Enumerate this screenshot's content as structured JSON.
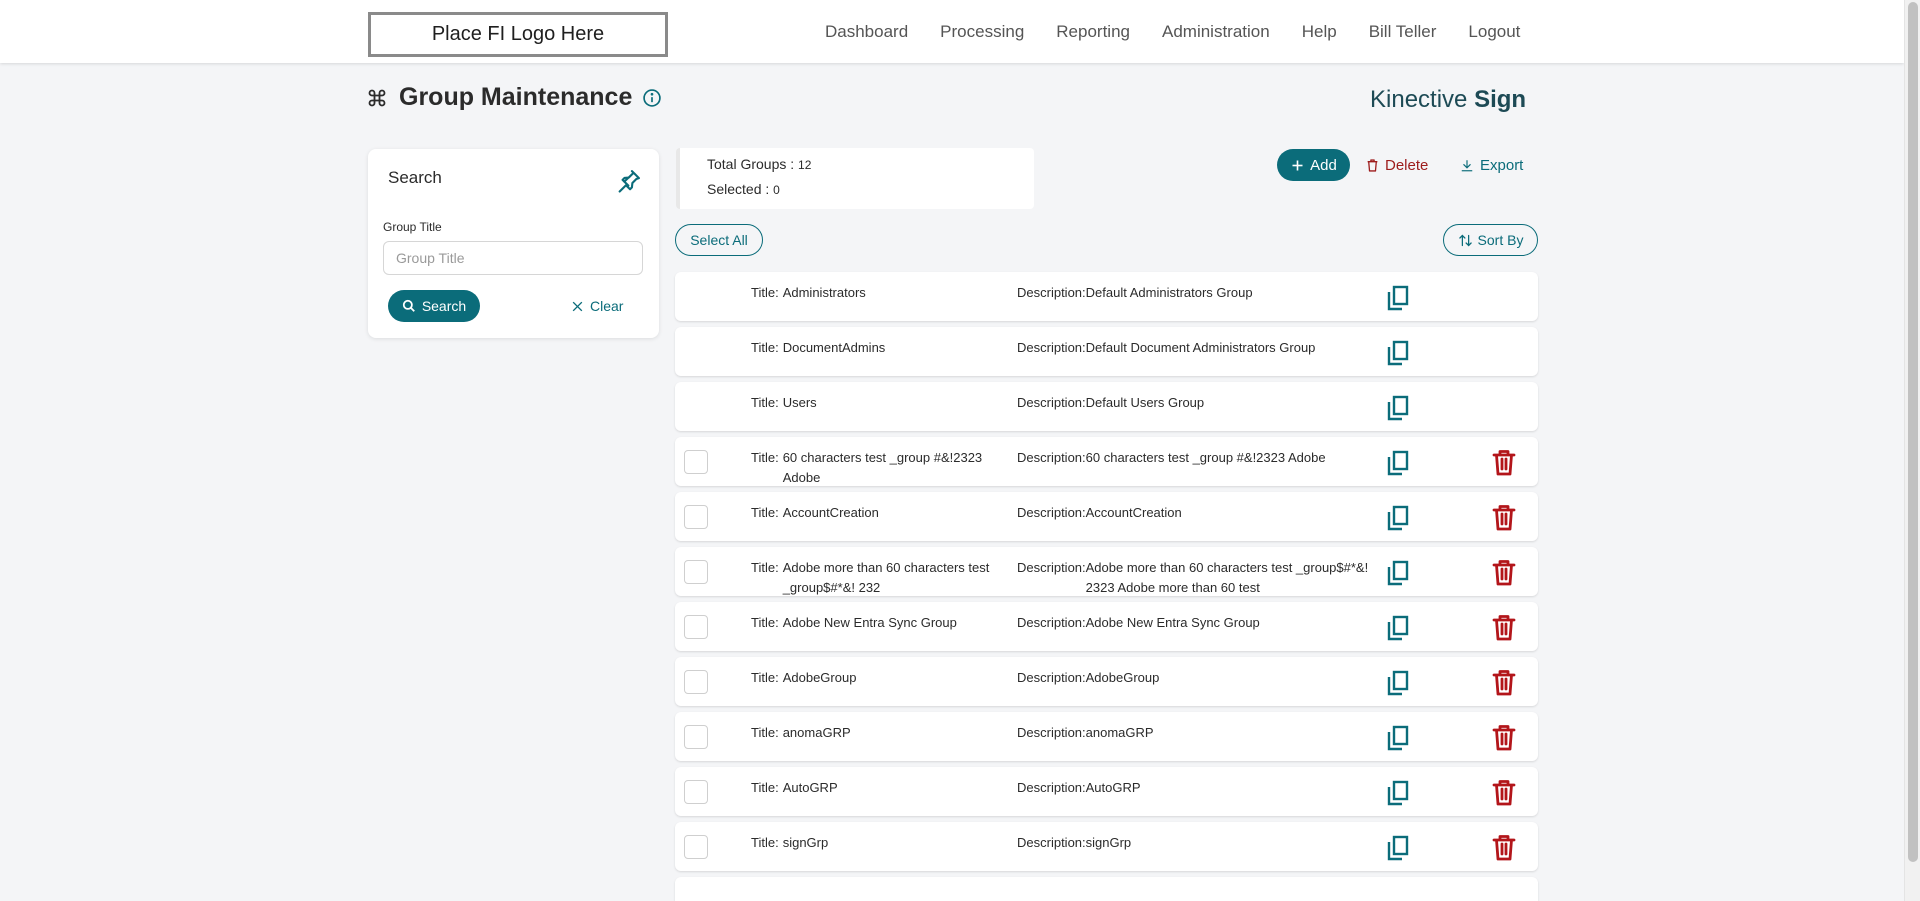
{
  "header": {
    "logo_text": "Place FI Logo Here",
    "nav": [
      "Dashboard",
      "Processing",
      "Reporting",
      "Administration",
      "Help",
      "Bill Teller",
      "Logout"
    ]
  },
  "page": {
    "title": "Group Maintenance",
    "title_icon": "command-icon",
    "info_icon": "info-icon",
    "brand_light": "Kinective",
    "brand_bold": "Sign"
  },
  "search": {
    "heading": "Search",
    "field_label": "Group Title",
    "field_placeholder": "Group Title",
    "field_value": "",
    "search_label": "Search",
    "clear_label": "Clear"
  },
  "summary": {
    "total_label": "Total Groups :",
    "total_value": "12",
    "selected_label": "Selected :",
    "selected_value": "0"
  },
  "actions": {
    "add": "Add",
    "delete": "Delete",
    "export": "Export",
    "select_all": "Select All",
    "sort_by": "Sort By"
  },
  "colors": {
    "accent": "#0b6c7a",
    "danger": "#9d1c1c"
  },
  "groups": [
    {
      "title": "Administrators",
      "description": "Default Administrators Group",
      "deletable": false
    },
    {
      "title": "DocumentAdmins",
      "description": "Default Document Administrators Group",
      "deletable": false
    },
    {
      "title": "Users",
      "description": "Default Users Group",
      "deletable": false
    },
    {
      "title": "60 characters test _group #&!2323 Adobe",
      "description": "60 characters test _group #&!2323 Adobe",
      "deletable": true
    },
    {
      "title": "AccountCreation",
      "description": "AccountCreation",
      "deletable": true
    },
    {
      "title": "Adobe more than 60 characters test _group$#*&! 232",
      "description": "Adobe more than 60 characters test _group$#*&! 2323 Adobe more than 60 test",
      "deletable": true
    },
    {
      "title": "Adobe New Entra Sync Group",
      "description": "Adobe New Entra Sync Group",
      "deletable": true
    },
    {
      "title": "AdobeGroup",
      "description": "AdobeGroup",
      "deletable": true
    },
    {
      "title": "anomaGRP",
      "description": "anomaGRP",
      "deletable": true
    },
    {
      "title": "AutoGRP",
      "description": "AutoGRP",
      "deletable": true
    },
    {
      "title": "signGrp",
      "description": "signGrp",
      "deletable": true
    }
  ],
  "row_labels": {
    "title": "Title:",
    "description": "Description:"
  }
}
